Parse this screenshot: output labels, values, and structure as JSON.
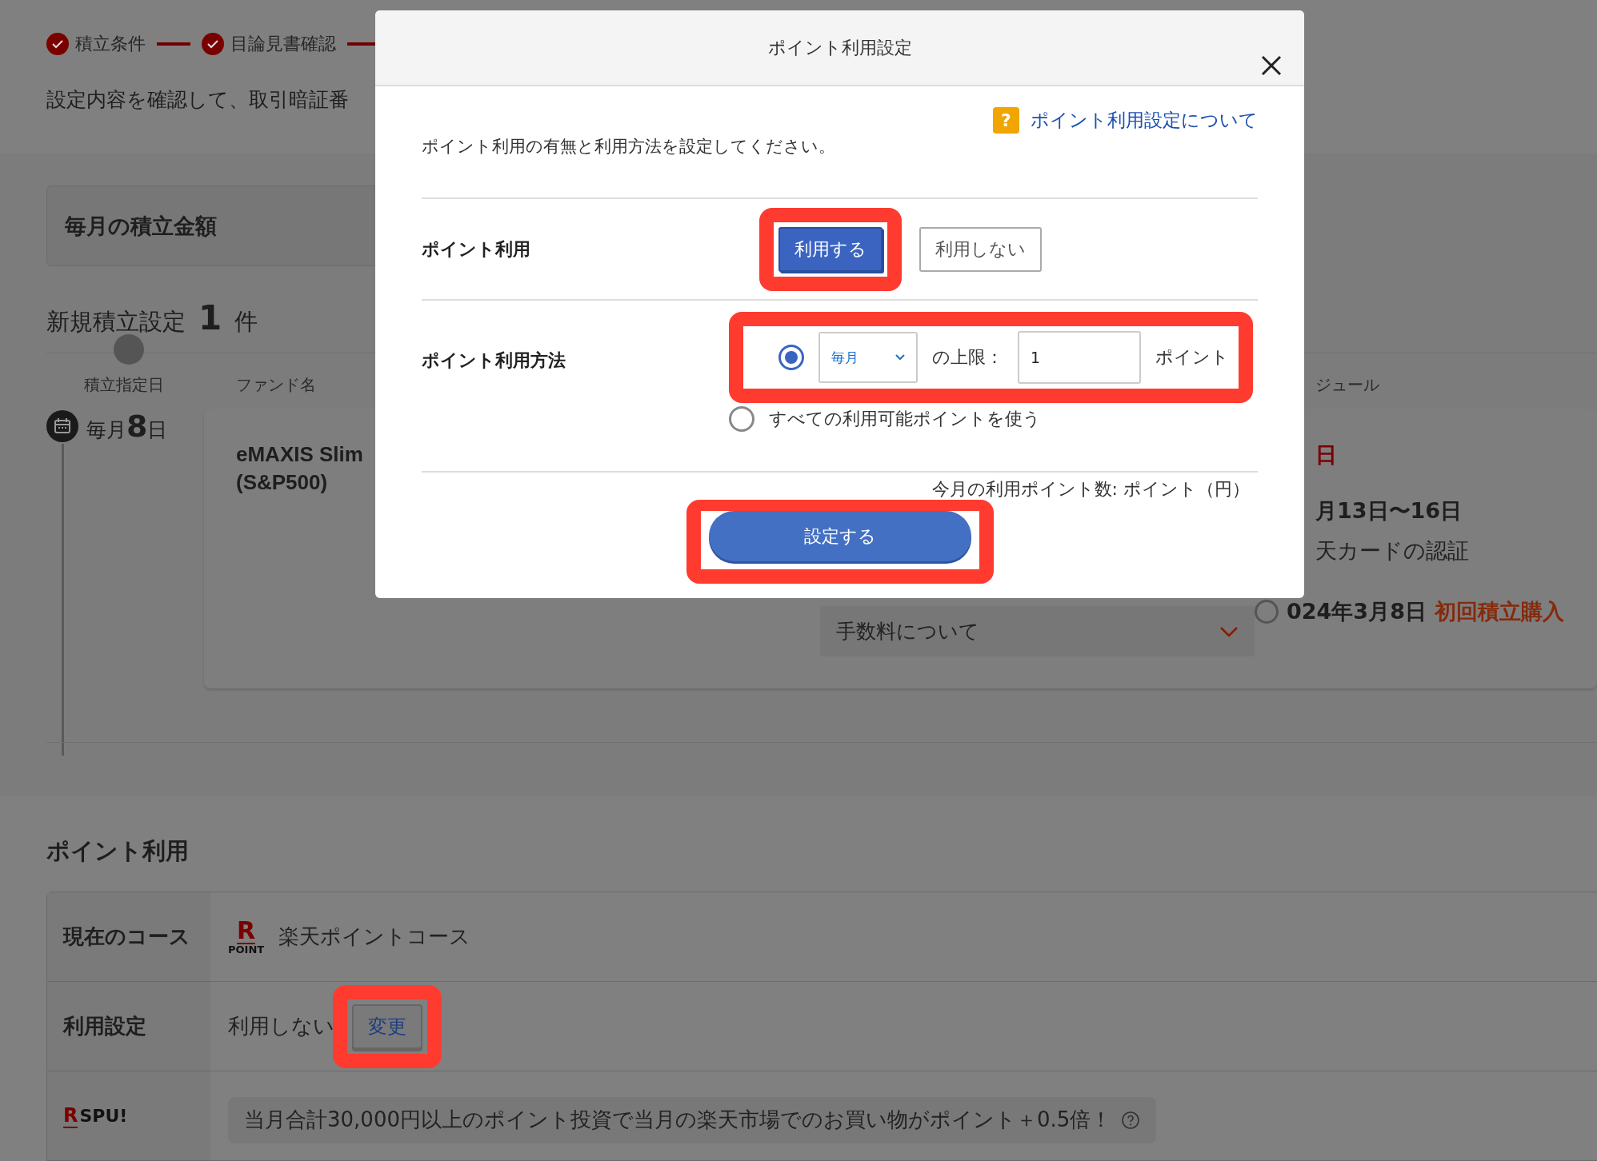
{
  "progress_steps": [
    {
      "label": "積立条件",
      "done": true
    },
    {
      "label": "目論見書確認",
      "done": true
    }
  ],
  "instruction": "設定内容を確認して、取引暗証番",
  "monthly_amount_card": {
    "title": "毎月の積立金額"
  },
  "new_plans": {
    "title": "新規積立設定",
    "count": "1",
    "unit": "件"
  },
  "plan_table": {
    "columns": [
      "積立指定日",
      "ファンド名",
      "ジュール"
    ],
    "rows": [
      {
        "day_prefix": "毎月",
        "day": "8",
        "day_suffix": "日",
        "fund": [
          "eMAXIS Slim",
          "(S&P500)"
        ],
        "fee_toggle": {
          "label": "手数料について",
          "expanded": false
        },
        "schedule": [
          {
            "kind": "deadline",
            "text": "日"
          },
          {
            "kind": "date",
            "text": "月13日〜16日"
          },
          {
            "kind": "note",
            "text": "天カードの認証"
          },
          {
            "kind": "milestone",
            "date": "024年3月8日",
            "label": "初回積立購入",
            "done": false
          }
        ]
      }
    ]
  },
  "point_usage": {
    "title": "ポイント利用",
    "rows": [
      {
        "kind": "course",
        "label": "現在のコース",
        "logo_mark": "R",
        "logo_text": "POINT",
        "value": "楽天ポイントコース"
      },
      {
        "kind": "setting",
        "label": "利用設定",
        "value": "利用しない",
        "button": "変更",
        "highlighted": true
      },
      {
        "kind": "spu",
        "logo_mark": "R",
        "logo_text": "SPU!",
        "value": "当月合計30,000円以上のポイント投資で当月の楽天市場でのお買い物がポイント＋0.5倍！"
      }
    ]
  },
  "dialog": {
    "title": "ポイント利用設定",
    "help_icon": "?",
    "help_link": "ポイント利用設定について",
    "description": "ポイント利用の有無と利用方法を設定してください。",
    "usage": {
      "label": "ポイント利用",
      "highlighted": true,
      "options": [
        {
          "label": "利用する",
          "selected": true
        },
        {
          "label": "利用しない",
          "selected": false
        }
      ]
    },
    "method": {
      "label": "ポイント利用方法",
      "options": [
        {
          "kind": "limit",
          "selected": true,
          "highlighted": true,
          "period": "毎月",
          "limit_label": "の上限：",
          "value": "1",
          "unit": "ポイント"
        },
        {
          "kind": "all",
          "selected": false,
          "label": "すべての利用可能ポイントを使う"
        }
      ]
    },
    "monthly_points": "今月の利用ポイント数: ポイント（円）",
    "submit": {
      "label": "設定する",
      "highlighted": true
    }
  }
}
